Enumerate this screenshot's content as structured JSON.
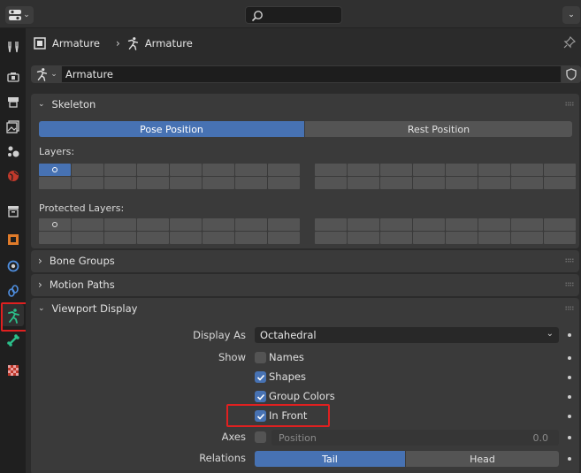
{
  "breadcrumb": {
    "object_name": "Armature",
    "data_name": "Armature"
  },
  "datablock": {
    "name": "Armature"
  },
  "skeleton": {
    "title": "Skeleton",
    "pose_position_label": "Pose Position",
    "rest_position_label": "Rest Position",
    "pose_mode_selected": "Pose Position",
    "layers_label": "Layers:",
    "protected_layers_label": "Protected Layers:"
  },
  "bone_groups": {
    "title": "Bone Groups"
  },
  "motion_paths": {
    "title": "Motion Paths"
  },
  "viewport_display": {
    "title": "Viewport Display",
    "display_as_label": "Display As",
    "display_as_value": "Octahedral",
    "show_label": "Show",
    "names_label": "Names",
    "names_checked": false,
    "shapes_label": "Shapes",
    "shapes_checked": true,
    "group_colors_label": "Group Colors",
    "group_colors_checked": true,
    "in_front_label": "In Front",
    "in_front_checked": true,
    "axes_label": "Axes",
    "axes_checked": false,
    "position_label": "Position",
    "position_value": "0.0",
    "relations_label": "Relations",
    "relations_tail_label": "Tail",
    "relations_head_label": "Head",
    "relations_selected": "Tail"
  },
  "tabs": [
    "tool-tab",
    "render-tab",
    "output-tab",
    "view-layer-tab",
    "scene-tab",
    "world-tab",
    "collection-tab",
    "object-tab",
    "modifiers-tab",
    "physics-tab",
    "constraints-tab",
    "object-data-armature-tab",
    "bone-tab",
    "texture-tab"
  ],
  "active_tab": "object-data-armature-tab",
  "colors": {
    "accent": "#4772b3",
    "highlight": "#e02020",
    "armature_icon": "#2bc08b"
  }
}
